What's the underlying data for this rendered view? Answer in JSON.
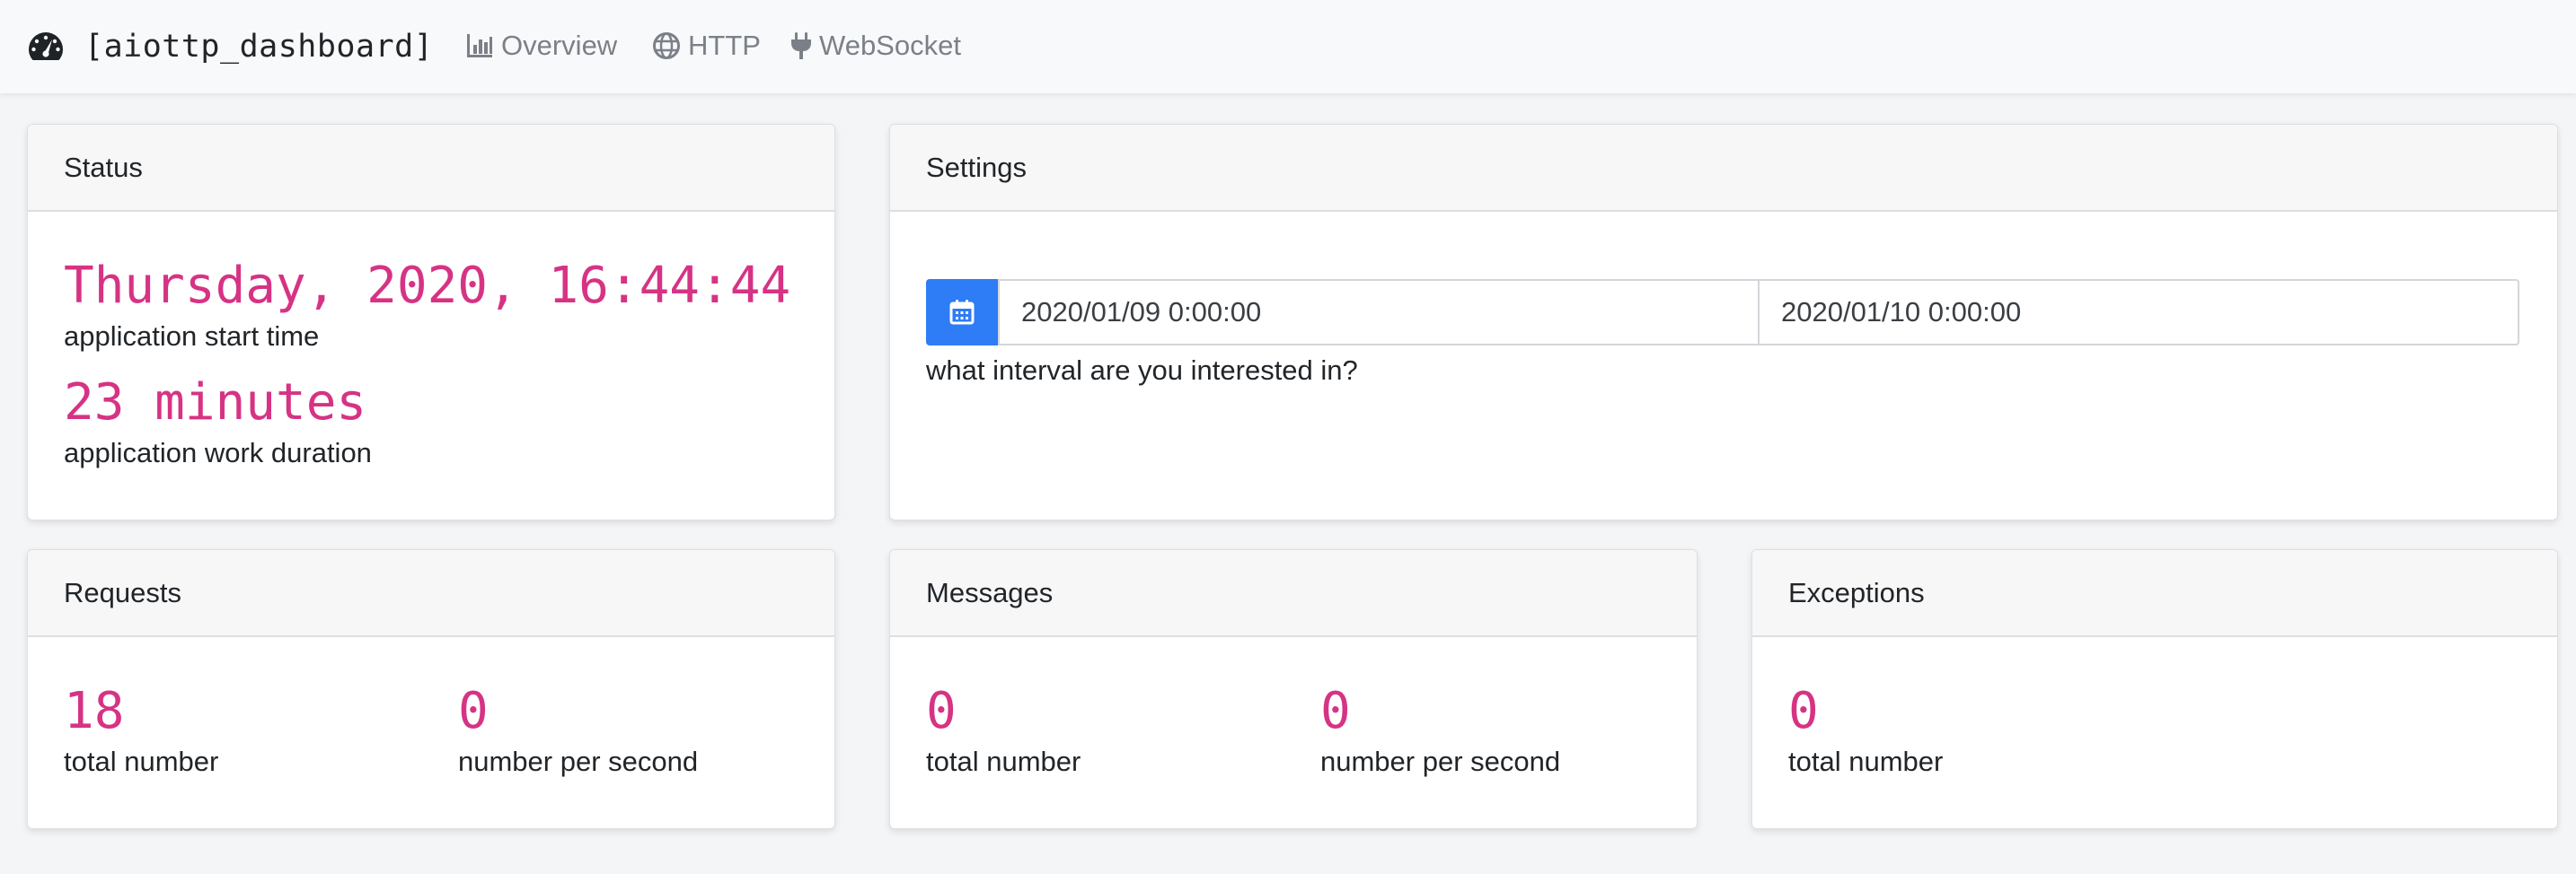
{
  "navbar": {
    "brand_icon": "tachometer-icon",
    "brand": "[aiottp_dashboard]",
    "links": [
      {
        "icon": "bar-chart-icon",
        "label": "Overview"
      },
      {
        "icon": "globe-icon",
        "label": "HTTP"
      },
      {
        "icon": "plug-icon",
        "label": "WebSocket"
      }
    ]
  },
  "status": {
    "title": "Status",
    "start_time": "Thursday, 2020, 16:44:44",
    "start_time_caption": "application start time",
    "duration": "23 minutes",
    "duration_caption": "application work duration"
  },
  "settings": {
    "title": "Settings",
    "calendar_icon": "calendar-icon",
    "date_from": "2020/01/09 0:00:00",
    "date_to": "2020/01/10 0:00:00",
    "caption": "what interval are you interested in?"
  },
  "requests": {
    "title": "Requests",
    "total": "18",
    "total_caption": "total number",
    "per_second": "0",
    "per_second_caption": "number per second"
  },
  "messages": {
    "title": "Messages",
    "total": "0",
    "total_caption": "total number",
    "per_second": "0",
    "per_second_caption": "number per second"
  },
  "exceptions": {
    "title": "Exceptions",
    "total": "0",
    "total_caption": "total number"
  },
  "colors": {
    "accent_value": "#d63384",
    "primary": "#2e7cf6",
    "nav_link": "#7b8088",
    "navbar_bg": "#f8f9fa",
    "page_bg": "#f4f5f7"
  }
}
